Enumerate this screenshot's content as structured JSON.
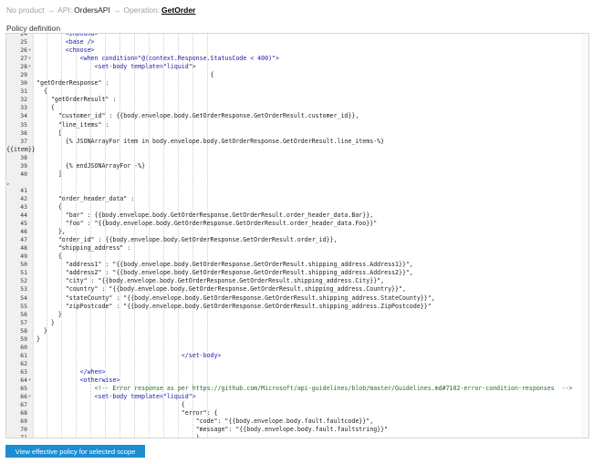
{
  "breadcrumb": {
    "product": "No product",
    "api_prefix": "API:",
    "api_name": "OrdersAPI",
    "operation_prefix": "Operation:",
    "operation_name": "GetOrder",
    "separator": "→"
  },
  "section_title": "Policy definition",
  "editor": {
    "lines": [
      {
        "n": "24",
        "fold": "",
        "text": "        <inbound>",
        "kind": "tag"
      },
      {
        "n": "25",
        "fold": "",
        "text": "        <base />",
        "kind": "tag"
      },
      {
        "n": "26",
        "fold": "▾",
        "text": "        <choose>",
        "kind": "tag"
      },
      {
        "n": "27",
        "fold": "▾",
        "text": "            <when condition=\"@(context.Response.StatusCode < 400)\">",
        "kind": "tag"
      },
      {
        "n": "28",
        "fold": "▾",
        "text": "                <set-body template=\"liquid\">",
        "kind": "tag"
      },
      {
        "n": "29",
        "fold": "",
        "text": "                                                {",
        "kind": "plain"
      },
      {
        "n": "30",
        "fold": "",
        "text": "\"getOrderResponse\" :",
        "kind": "plain"
      },
      {
        "n": "31",
        "fold": "",
        "text": "  {",
        "kind": "plain"
      },
      {
        "n": "32",
        "fold": "",
        "text": "    \"getOrderResult\" :",
        "kind": "plain"
      },
      {
        "n": "33",
        "fold": "",
        "text": "    {",
        "kind": "plain"
      },
      {
        "n": "34",
        "fold": "",
        "text": "      \"customer_id\" : {{body.envelope.body.GetOrderResponse.GetOrderResult.customer_id}},",
        "kind": "plain"
      },
      {
        "n": "35",
        "fold": "",
        "text": "      \"line_items\" :",
        "kind": "plain"
      },
      {
        "n": "36",
        "fold": "",
        "text": "      [",
        "kind": "plain"
      },
      {
        "n": "37",
        "fold": "",
        "text": "        {% JSONArrayFor item in body.envelope.body.GetOrderResponse.GetOrderResult.line_items-%}",
        "kind": "plain"
      },
      {
        "n": "",
        "fold": "",
        "text": "{{item}}",
        "kind": "wrap"
      },
      {
        "n": "38",
        "fold": "",
        "text": "",
        "kind": "plain"
      },
      {
        "n": "39",
        "fold": "",
        "text": "        {% endJSONArrayFor -%}",
        "kind": "plain"
      },
      {
        "n": "40",
        "fold": "",
        "text": "      ]",
        "kind": "plain"
      },
      {
        "n": "",
        "fold": "",
        "text": ",",
        "kind": "wrap"
      },
      {
        "n": "41",
        "fold": "",
        "text": "",
        "kind": "plain"
      },
      {
        "n": "42",
        "fold": "",
        "text": "      \"order_header_data\" :",
        "kind": "plain"
      },
      {
        "n": "43",
        "fold": "",
        "text": "      {",
        "kind": "plain"
      },
      {
        "n": "44",
        "fold": "",
        "text": "        \"bar\" : {{body.envelope.body.GetOrderResponse.GetOrderResult.order_header_data.Bar}},",
        "kind": "plain"
      },
      {
        "n": "45",
        "fold": "",
        "text": "        \"foo\" : \"{{body.envelope.body.GetOrderResponse.GetOrderResult.order_header_data.Foo}}\"",
        "kind": "plain"
      },
      {
        "n": "46",
        "fold": "",
        "text": "      },",
        "kind": "plain"
      },
      {
        "n": "47",
        "fold": "",
        "text": "      \"order_id\" : {{body.envelope.body.GetOrderResponse.GetOrderResult.order_id}},",
        "kind": "plain"
      },
      {
        "n": "48",
        "fold": "",
        "text": "      \"shipping_address\" :",
        "kind": "plain"
      },
      {
        "n": "49",
        "fold": "",
        "text": "      {",
        "kind": "plain"
      },
      {
        "n": "50",
        "fold": "",
        "text": "        \"address1\" : \"{{body.envelope.body.GetOrderResponse.GetOrderResult.shipping_address.Address1}}\",",
        "kind": "plain"
      },
      {
        "n": "51",
        "fold": "",
        "text": "        \"address2\" : \"{{body.envelope.body.GetOrderResponse.GetOrderResult.shipping_address.Address2}}\",",
        "kind": "plain"
      },
      {
        "n": "52",
        "fold": "",
        "text": "        \"city\" : \"{{body.envelope.body.GetOrderResponse.GetOrderResult.shipping_address.City}}\",",
        "kind": "plain"
      },
      {
        "n": "53",
        "fold": "",
        "text": "        \"country\" : \"{{body.envelope.body.GetOrderResponse.GetOrderResult.shipping_address.Country}}\",",
        "kind": "plain"
      },
      {
        "n": "54",
        "fold": "",
        "text": "        \"stateCounty\" : \"{{body.envelope.body.GetOrderResponse.GetOrderResult.shipping_address.StateCounty}}\",",
        "kind": "plain"
      },
      {
        "n": "55",
        "fold": "",
        "text": "        \"zipPostcode\" : \"{{body.envelope.body.GetOrderResponse.GetOrderResult.shipping_address.ZipPostcode}}\"",
        "kind": "plain"
      },
      {
        "n": "56",
        "fold": "",
        "text": "      }",
        "kind": "plain"
      },
      {
        "n": "57",
        "fold": "",
        "text": "    }",
        "kind": "plain"
      },
      {
        "n": "58",
        "fold": "",
        "text": "  }",
        "kind": "plain"
      },
      {
        "n": "59",
        "fold": "",
        "text": "}",
        "kind": "plain"
      },
      {
        "n": "60",
        "fold": "",
        "text": "",
        "kind": "plain"
      },
      {
        "n": "61",
        "fold": "",
        "text": "                                        </set-body>",
        "kind": "tag"
      },
      {
        "n": "62",
        "fold": "",
        "text": "",
        "kind": "plain"
      },
      {
        "n": "63",
        "fold": "",
        "text": "            </when>",
        "kind": "tag"
      },
      {
        "n": "64",
        "fold": "▾",
        "text": "            <otherwise>",
        "kind": "tag"
      },
      {
        "n": "65",
        "fold": "",
        "text": "                <!-- Error response as per https://github.com/Microsoft/api-guidelines/blob/master/Guidelines.md#7102-error-condition-responses  -->",
        "kind": "comment"
      },
      {
        "n": "66",
        "fold": "▾",
        "text": "                <set-body template=\"liquid\">",
        "kind": "tag"
      },
      {
        "n": "67",
        "fold": "",
        "text": "                                        {",
        "kind": "plain"
      },
      {
        "n": "68",
        "fold": "",
        "text": "                                        \"error\": {",
        "kind": "plain"
      },
      {
        "n": "69",
        "fold": "",
        "text": "                                            \"code\": \"{{body.envelope.body.fault.faultcode}}\",",
        "kind": "plain"
      },
      {
        "n": "70",
        "fold": "",
        "text": "                                            \"message\": \"{{body.envelope.body.fault.faultstring}}\"",
        "kind": "plain"
      },
      {
        "n": "71",
        "fold": "",
        "text": "                                            }",
        "kind": "plain"
      },
      {
        "n": "72",
        "fold": "",
        "text": "                                        }",
        "kind": "plain"
      },
      {
        "n": "73",
        "fold": "",
        "text": "                                    </set-body>",
        "kind": "tag"
      },
      {
        "n": "74",
        "fold": "",
        "text": "            </otherwise>",
        "kind": "tag"
      }
    ]
  },
  "button": {
    "label": "View effective policy for selected scope"
  },
  "colors": {
    "accent": "#1d8dd2",
    "tag": "#1a1aa6",
    "comment": "#236e25"
  }
}
